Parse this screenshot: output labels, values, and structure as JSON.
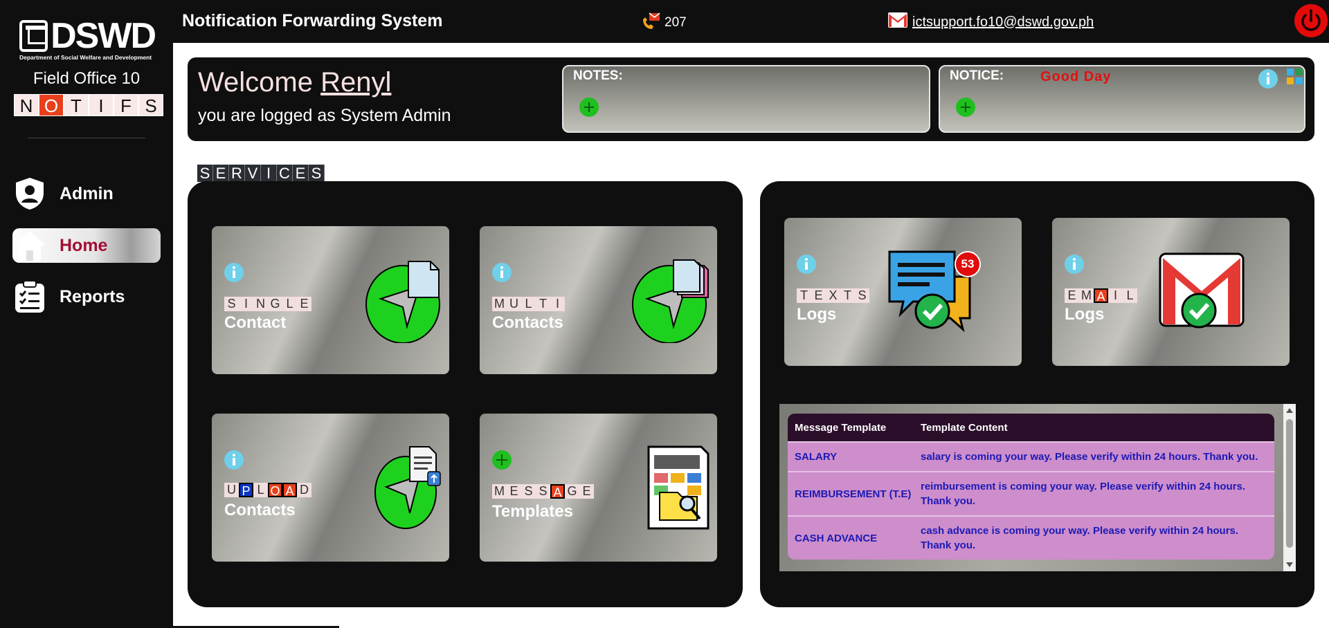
{
  "header": {
    "title": "Notification Forwarding System",
    "sms_count": "207",
    "support_email": "ictsupport.fo10@dswd.gov.ph"
  },
  "sidebar": {
    "logo_text": "DSWD",
    "logo_subtitle": "Department of Social Welfare and Development",
    "field_office": "Field Office 10",
    "brand_letters": [
      "N",
      "O",
      "T",
      "I",
      "F",
      "S"
    ],
    "items": [
      {
        "label": "Admin",
        "icon": "shield-user-icon"
      },
      {
        "label": "Home",
        "icon": "home-icon",
        "active": true
      },
      {
        "label": "Reports",
        "icon": "clipboard-icon"
      }
    ]
  },
  "welcome": {
    "greeting": "Welcome",
    "user": "Renyl",
    "role_text": "you are logged as System Admin",
    "notes_label": "NOTES:",
    "notice_label": "NOTICE:",
    "notice_message": "Good  Day"
  },
  "services": {
    "label_letters": [
      "S",
      "E",
      "R",
      "V",
      "I",
      "C",
      "E",
      "S"
    ],
    "cards": [
      {
        "id": "single",
        "letters": [
          "S",
          "I",
          "N",
          "G",
          "L",
          "E"
        ],
        "title": "Contact"
      },
      {
        "id": "multi",
        "letters": [
          "M",
          "U",
          "L",
          "T",
          "I"
        ],
        "title": "Contacts"
      },
      {
        "id": "upload",
        "letters": [
          "U",
          "P",
          "L",
          "O",
          "A",
          "D"
        ],
        "title": "Contacts"
      },
      {
        "id": "message",
        "letters": [
          "M",
          "E",
          "S",
          "S",
          "A",
          "G",
          "E"
        ],
        "title": "Templates"
      }
    ]
  },
  "logs": {
    "texts": {
      "letters": [
        "T",
        "E",
        "X",
        "T",
        "S"
      ],
      "title": "Logs",
      "badge": "53"
    },
    "email": {
      "letters": [
        "E",
        "M",
        "A",
        "I",
        "L"
      ],
      "title": "Logs"
    }
  },
  "templates_table": {
    "headers": [
      "Message Template",
      "Template Content"
    ],
    "rows": [
      {
        "name": "SALARY",
        "content": "salary is coming your way. Please verify within 24 hours. Thank you."
      },
      {
        "name": "REIMBURSEMENT (T.E)",
        "content": "reimbursement is coming your way. Please verify within 24 hours. Thank you."
      },
      {
        "name": "CASH ADVANCE",
        "content": "cash advance is coming your way. Please verify within 24 hours. Thank you."
      }
    ]
  },
  "colors": {
    "sidebar_bg": "#0f0f0f",
    "accent_red": "#e8401c",
    "active_text": "#a30d35",
    "green_icon": "#1fd11f",
    "info_blue": "#6fd0ea",
    "table_header": "#2b0e2a",
    "table_row": "#cd8ecb",
    "table_text": "#1d19b5"
  }
}
